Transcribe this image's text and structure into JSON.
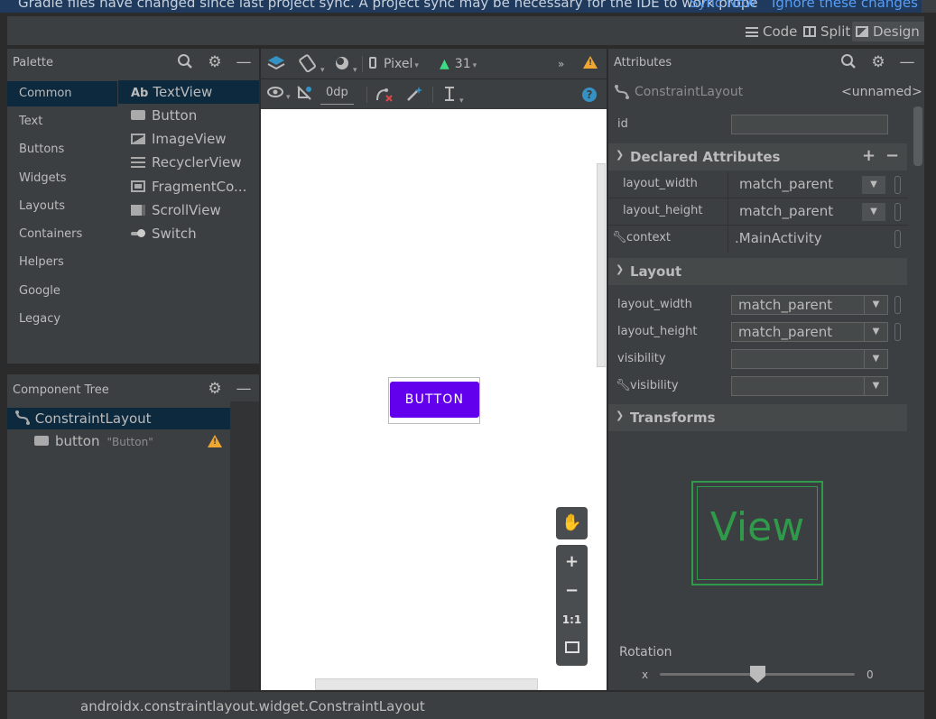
{
  "banner": {
    "message": "Gradle files have changed since last project sync. A project sync may be necessary for the IDE to work prope",
    "sync_link": "Sync Now",
    "ignore_link": "Ignore these changes"
  },
  "view_modes": {
    "code": "Code",
    "split": "Split",
    "design": "Design",
    "selected": "Design"
  },
  "palette": {
    "title": "Palette",
    "categories": [
      "Common",
      "Text",
      "Buttons",
      "Widgets",
      "Layouts",
      "Containers",
      "Helpers",
      "Google",
      "Legacy"
    ],
    "selected_category": "Common",
    "widgets": [
      {
        "label": "TextView",
        "icon": "textview-icon",
        "prefix": "Ab"
      },
      {
        "label": "Button",
        "icon": "button-icon"
      },
      {
        "label": "ImageView",
        "icon": "imageview-icon"
      },
      {
        "label": "RecyclerView",
        "icon": "recyclerview-icon"
      },
      {
        "label": "FragmentCo...",
        "icon": "fragment-icon"
      },
      {
        "label": "ScrollView",
        "icon": "scrollview-icon"
      },
      {
        "label": "Switch",
        "icon": "switch-icon"
      }
    ]
  },
  "component_tree": {
    "title": "Component Tree",
    "root": "ConstraintLayout",
    "child": {
      "name": "button",
      "text": "\"Button\"",
      "warning": true
    }
  },
  "design_toolbar": {
    "device": "Pixel",
    "api_level": "31",
    "margin": "0dp"
  },
  "canvas": {
    "button_text": "BUTTON",
    "button_color": "#6200ee",
    "zoom_controls": {
      "fit": "1:1"
    }
  },
  "attributes": {
    "title": "Attributes",
    "component": "ConstraintLayout",
    "component_id": "<unnamed>",
    "id_label": "id",
    "id_value": "",
    "declared_section": "Declared Attributes",
    "declared": [
      {
        "name": "layout_width",
        "value": "match_parent"
      },
      {
        "name": "layout_height",
        "value": "match_parent"
      },
      {
        "name": "context",
        "value": ".MainActivity",
        "tool": true
      }
    ],
    "layout_section": "Layout",
    "layout": [
      {
        "name": "layout_width",
        "value": "match_parent"
      },
      {
        "name": "layout_height",
        "value": "match_parent"
      },
      {
        "name": "visibility",
        "value": ""
      },
      {
        "name": "visibility",
        "value": "",
        "tool": true
      }
    ],
    "transforms_section": "Transforms",
    "view_preview_text": "View",
    "rotation_label": "Rotation",
    "rotation_axis": "x",
    "rotation_value": "0"
  },
  "status_bar": {
    "text": "androidx.constraintlayout.widget.ConstraintLayout"
  },
  "colors": {
    "accent_green": "#2f9b4a",
    "warning": "#f0a732",
    "selection": "#0d293e"
  }
}
